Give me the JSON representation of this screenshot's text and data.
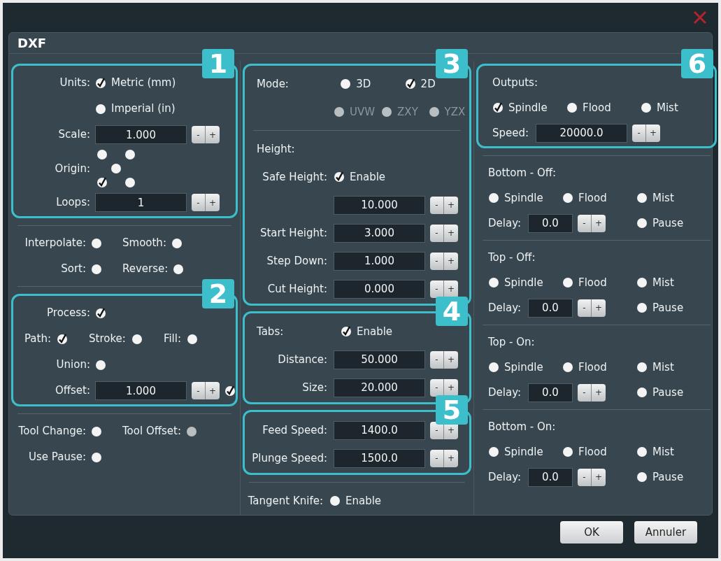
{
  "dialog": {
    "title": "DXF"
  },
  "columns": [
    {
      "kind": "left",
      "blocks": [
        {
          "callout": "1",
          "rows": [
            {
              "kind": "form",
              "label": "Units:",
              "items": [
                {
                  "kind": "check",
                  "text": "Metric (mm)",
                  "checked": true
                }
              ]
            },
            {
              "kind": "form",
              "items": [
                {
                  "kind": "check",
                  "text": "Imperial (in)",
                  "checked": false
                }
              ]
            },
            {
              "kind": "form",
              "label": "Scale:",
              "items": [
                {
                  "kind": "spin",
                  "value": "1.000",
                  "minus": "-",
                  "plus": "+"
                }
              ]
            },
            {
              "kind": "form",
              "label": "Origin:",
              "items": [
                {
                  "kind": "origin",
                  "points": [
                    {
                      "checked": false
                    },
                    {
                      "checked": false
                    },
                    {
                      "checked": false
                    },
                    {
                      "checked": true
                    },
                    {
                      "checked": false
                    }
                  ]
                }
              ]
            },
            {
              "kind": "form",
              "label": "Loops:",
              "items": [
                {
                  "kind": "spin",
                  "value": "1",
                  "minus": "-",
                  "plus": "+"
                }
              ]
            }
          ]
        },
        {
          "rows": [
            {
              "kind": "divider"
            },
            {
              "kind": "form",
              "label": "Interpolate:",
              "items": [
                {
                  "kind": "check",
                  "checked": false
                },
                {
                  "kind": "label",
                  "text": "Smooth:"
                },
                {
                  "kind": "check",
                  "checked": false
                }
              ]
            },
            {
              "kind": "form",
              "label": "Sort:",
              "items": [
                {
                  "kind": "check",
                  "checked": false
                },
                {
                  "kind": "label",
                  "text": "Reverse:"
                },
                {
                  "kind": "check",
                  "checked": false
                }
              ]
            },
            {
              "kind": "divider"
            }
          ]
        },
        {
          "callout": "2",
          "rows": [
            {
              "kind": "form",
              "label": "Process:",
              "items": [
                {
                  "kind": "check",
                  "checked": true
                }
              ]
            },
            {
              "kind": "inline",
              "items": [
                {
                  "kind": "label",
                  "text": "Path:"
                },
                {
                  "kind": "check",
                  "checked": true
                },
                {
                  "kind": "label",
                  "text": "Stroke:"
                },
                {
                  "kind": "check",
                  "checked": false
                },
                {
                  "kind": "label",
                  "text": "Fill:"
                },
                {
                  "kind": "check",
                  "checked": false
                }
              ]
            },
            {
              "kind": "form",
              "label": "Union:",
              "items": [
                {
                  "kind": "check",
                  "checked": false
                }
              ]
            },
            {
              "kind": "form",
              "label": "Offset:",
              "items": [
                {
                  "kind": "spin",
                  "value": "1.000",
                  "minus": "-",
                  "plus": "+"
                },
                {
                  "kind": "check",
                  "checked": true
                }
              ]
            }
          ]
        },
        {
          "rows": [
            {
              "kind": "divider"
            },
            {
              "kind": "form",
              "label": "Tool Change:",
              "items": [
                {
                  "kind": "check",
                  "checked": false
                },
                {
                  "kind": "label",
                  "text": "Tool Offset:"
                },
                {
                  "kind": "check",
                  "checked": false,
                  "disabled": true
                }
              ]
            },
            {
              "kind": "form",
              "label": "Use Pause:",
              "items": [
                {
                  "kind": "check",
                  "checked": false
                }
              ]
            }
          ]
        }
      ]
    },
    {
      "kind": "middle",
      "blocks": [
        {
          "callout": "3",
          "rows": [
            {
              "kind": "inline",
              "items": [
                {
                  "kind": "label",
                  "text": "Mode:"
                },
                {
                  "kind": "check",
                  "text": "3D",
                  "checked": false
                },
                {
                  "kind": "check",
                  "text": "2D",
                  "checked": true
                }
              ]
            },
            {
              "kind": "form",
              "items": [
                {
                  "kind": "check",
                  "text": "UVW",
                  "checked": false,
                  "disabled": true
                },
                {
                  "kind": "check",
                  "text": "ZXY",
                  "checked": false,
                  "disabled": true
                },
                {
                  "kind": "check",
                  "text": "YZX",
                  "checked": false,
                  "disabled": true
                }
              ]
            },
            {
              "kind": "divider"
            },
            {
              "kind": "inline",
              "items": [
                {
                  "kind": "label",
                  "text": "Height:"
                }
              ]
            },
            {
              "kind": "form",
              "label": "Safe Height:",
              "items": [
                {
                  "kind": "check",
                  "text": "Enable",
                  "checked": true
                }
              ]
            },
            {
              "kind": "form",
              "items": [
                {
                  "kind": "spin",
                  "value": "10.000",
                  "minus": "-",
                  "plus": "+"
                }
              ]
            },
            {
              "kind": "form",
              "label": "Start Height:",
              "items": [
                {
                  "kind": "spin",
                  "value": "3.000",
                  "minus": "-",
                  "plus": "+"
                }
              ]
            },
            {
              "kind": "form",
              "label": "Step Down:",
              "items": [
                {
                  "kind": "spin",
                  "value": "1.000",
                  "minus": "-",
                  "plus": "+"
                }
              ]
            },
            {
              "kind": "form",
              "label": "Cut Height:",
              "items": [
                {
                  "kind": "spin",
                  "value": "0.000",
                  "minus": "-",
                  "plus": "+"
                }
              ]
            }
          ]
        },
        {
          "callout": "4",
          "rows": [
            {
              "kind": "inline",
              "items": [
                {
                  "kind": "label",
                  "text": "Tabs:"
                },
                {
                  "kind": "check",
                  "text": "Enable",
                  "checked": true
                }
              ]
            },
            {
              "kind": "form",
              "label": "Distance:",
              "items": [
                {
                  "kind": "spin",
                  "value": "50.000",
                  "minus": "-",
                  "plus": "+"
                }
              ]
            },
            {
              "kind": "form",
              "label": "Size:",
              "items": [
                {
                  "kind": "spin",
                  "value": "20.000",
                  "minus": "-",
                  "plus": "+"
                }
              ]
            }
          ]
        },
        {
          "callout": "5",
          "rows": [
            {
              "kind": "form",
              "label": "Feed Speed:",
              "items": [
                {
                  "kind": "spin",
                  "value": "1400.0",
                  "minus": "-",
                  "plus": "+"
                }
              ]
            },
            {
              "kind": "form",
              "label": "Plunge Speed:",
              "items": [
                {
                  "kind": "spin",
                  "value": "1500.0",
                  "minus": "-",
                  "plus": "+"
                }
              ]
            }
          ]
        },
        {
          "rows": [
            {
              "kind": "divider"
            },
            {
              "kind": "form",
              "label": "Tangent Knife:",
              "items": [
                {
                  "kind": "check",
                  "text": "Enable",
                  "checked": false
                }
              ]
            }
          ]
        }
      ]
    },
    {
      "kind": "right",
      "blocks": [
        {
          "callout": "6",
          "rows": [
            {
              "kind": "inline",
              "items": [
                {
                  "kind": "label",
                  "text": "Outputs:"
                }
              ]
            },
            {
              "kind": "inline",
              "items": [
                {
                  "kind": "check",
                  "text": "Spindle",
                  "checked": true
                },
                {
                  "kind": "check",
                  "text": "Flood",
                  "checked": false
                },
                {
                  "kind": "check",
                  "text": "Mist",
                  "checked": false
                }
              ]
            },
            {
              "kind": "form",
              "label": "Speed:",
              "items": [
                {
                  "kind": "spin",
                  "value": "20000.0",
                  "minus": "-",
                  "plus": "+"
                }
              ]
            }
          ]
        },
        {
          "rows": [
            {
              "kind": "divider"
            },
            {
              "kind": "inline",
              "items": [
                {
                  "kind": "label",
                  "text": "Bottom - Off:"
                }
              ]
            },
            {
              "kind": "inline",
              "items": [
                {
                  "kind": "check",
                  "text": "Spindle",
                  "checked": false
                },
                {
                  "kind": "check",
                  "text": "Flood",
                  "checked": false
                },
                {
                  "kind": "check",
                  "text": "Mist",
                  "checked": false
                }
              ]
            },
            {
              "kind": "form",
              "label": "Delay:",
              "items": [
                {
                  "kind": "spin_short",
                  "value": "0.0",
                  "minus": "-",
                  "plus": "+"
                },
                {
                  "kind": "check",
                  "text": "Pause",
                  "checked": false
                }
              ]
            },
            {
              "kind": "divider"
            },
            {
              "kind": "inline",
              "items": [
                {
                  "kind": "label",
                  "text": "Top - Off:"
                }
              ]
            },
            {
              "kind": "inline",
              "items": [
                {
                  "kind": "check",
                  "text": "Spindle",
                  "checked": false
                },
                {
                  "kind": "check",
                  "text": "Flood",
                  "checked": false
                },
                {
                  "kind": "check",
                  "text": "Mist",
                  "checked": false
                }
              ]
            },
            {
              "kind": "form",
              "label": "Delay:",
              "items": [
                {
                  "kind": "spin_short",
                  "value": "0.0",
                  "minus": "-",
                  "plus": "+"
                },
                {
                  "kind": "check",
                  "text": "Pause",
                  "checked": false
                }
              ]
            },
            {
              "kind": "divider"
            },
            {
              "kind": "inline",
              "items": [
                {
                  "kind": "label",
                  "text": "Top - On:"
                }
              ]
            },
            {
              "kind": "inline",
              "items": [
                {
                  "kind": "check",
                  "text": "Spindle",
                  "checked": false
                },
                {
                  "kind": "check",
                  "text": "Flood",
                  "checked": false
                },
                {
                  "kind": "check",
                  "text": "Mist",
                  "checked": false
                }
              ]
            },
            {
              "kind": "form",
              "label": "Delay:",
              "items": [
                {
                  "kind": "spin_short",
                  "value": "0.0",
                  "minus": "-",
                  "plus": "+"
                },
                {
                  "kind": "check",
                  "text": "Pause",
                  "checked": false
                }
              ]
            },
            {
              "kind": "divider"
            },
            {
              "kind": "inline",
              "items": [
                {
                  "kind": "label",
                  "text": "Bottom - On:"
                }
              ]
            },
            {
              "kind": "inline",
              "items": [
                {
                  "kind": "check",
                  "text": "Spindle",
                  "checked": false
                },
                {
                  "kind": "check",
                  "text": "Flood",
                  "checked": false
                },
                {
                  "kind": "check",
                  "text": "Mist",
                  "checked": false
                }
              ]
            },
            {
              "kind": "form",
              "label": "Delay:",
              "items": [
                {
                  "kind": "spin_short",
                  "value": "0.0",
                  "minus": "-",
                  "plus": "+"
                },
                {
                  "kind": "check",
                  "text": "Pause",
                  "checked": false
                }
              ]
            }
          ]
        }
      ]
    }
  ],
  "buttons": [
    "OK",
    "Annuler"
  ]
}
